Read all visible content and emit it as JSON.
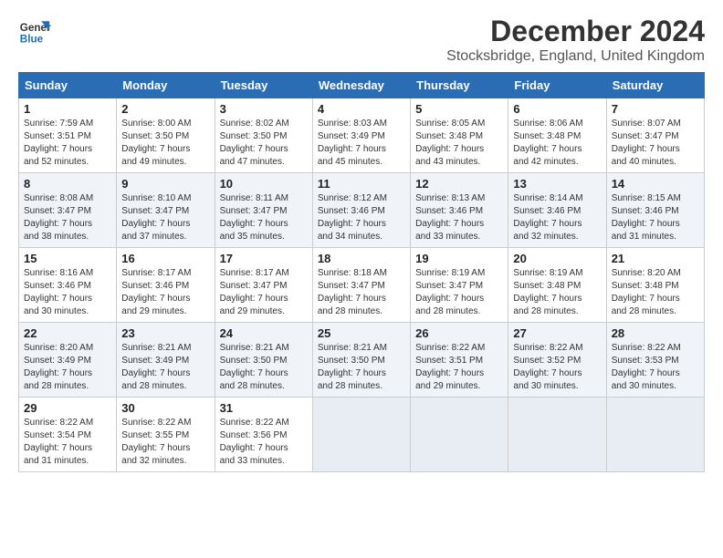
{
  "logo": {
    "line1": "General",
    "line2": "Blue"
  },
  "title": "December 2024",
  "subtitle": "Stocksbridge, England, United Kingdom",
  "headers": [
    "Sunday",
    "Monday",
    "Tuesday",
    "Wednesday",
    "Thursday",
    "Friday",
    "Saturday"
  ],
  "weeks": [
    [
      {
        "day": "1",
        "sunrise": "7:59 AM",
        "sunset": "3:51 PM",
        "daylight": "7 hours and 52 minutes."
      },
      {
        "day": "2",
        "sunrise": "8:00 AM",
        "sunset": "3:50 PM",
        "daylight": "7 hours and 49 minutes."
      },
      {
        "day": "3",
        "sunrise": "8:02 AM",
        "sunset": "3:50 PM",
        "daylight": "7 hours and 47 minutes."
      },
      {
        "day": "4",
        "sunrise": "8:03 AM",
        "sunset": "3:49 PM",
        "daylight": "7 hours and 45 minutes."
      },
      {
        "day": "5",
        "sunrise": "8:05 AM",
        "sunset": "3:48 PM",
        "daylight": "7 hours and 43 minutes."
      },
      {
        "day": "6",
        "sunrise": "8:06 AM",
        "sunset": "3:48 PM",
        "daylight": "7 hours and 42 minutes."
      },
      {
        "day": "7",
        "sunrise": "8:07 AM",
        "sunset": "3:47 PM",
        "daylight": "7 hours and 40 minutes."
      }
    ],
    [
      {
        "day": "8",
        "sunrise": "8:08 AM",
        "sunset": "3:47 PM",
        "daylight": "7 hours and 38 minutes."
      },
      {
        "day": "9",
        "sunrise": "8:10 AM",
        "sunset": "3:47 PM",
        "daylight": "7 hours and 37 minutes."
      },
      {
        "day": "10",
        "sunrise": "8:11 AM",
        "sunset": "3:47 PM",
        "daylight": "7 hours and 35 minutes."
      },
      {
        "day": "11",
        "sunrise": "8:12 AM",
        "sunset": "3:46 PM",
        "daylight": "7 hours and 34 minutes."
      },
      {
        "day": "12",
        "sunrise": "8:13 AM",
        "sunset": "3:46 PM",
        "daylight": "7 hours and 33 minutes."
      },
      {
        "day": "13",
        "sunrise": "8:14 AM",
        "sunset": "3:46 PM",
        "daylight": "7 hours and 32 minutes."
      },
      {
        "day": "14",
        "sunrise": "8:15 AM",
        "sunset": "3:46 PM",
        "daylight": "7 hours and 31 minutes."
      }
    ],
    [
      {
        "day": "15",
        "sunrise": "8:16 AM",
        "sunset": "3:46 PM",
        "daylight": "7 hours and 30 minutes."
      },
      {
        "day": "16",
        "sunrise": "8:17 AM",
        "sunset": "3:46 PM",
        "daylight": "7 hours and 29 minutes."
      },
      {
        "day": "17",
        "sunrise": "8:17 AM",
        "sunset": "3:47 PM",
        "daylight": "7 hours and 29 minutes."
      },
      {
        "day": "18",
        "sunrise": "8:18 AM",
        "sunset": "3:47 PM",
        "daylight": "7 hours and 28 minutes."
      },
      {
        "day": "19",
        "sunrise": "8:19 AM",
        "sunset": "3:47 PM",
        "daylight": "7 hours and 28 minutes."
      },
      {
        "day": "20",
        "sunrise": "8:19 AM",
        "sunset": "3:48 PM",
        "daylight": "7 hours and 28 minutes."
      },
      {
        "day": "21",
        "sunrise": "8:20 AM",
        "sunset": "3:48 PM",
        "daylight": "7 hours and 28 minutes."
      }
    ],
    [
      {
        "day": "22",
        "sunrise": "8:20 AM",
        "sunset": "3:49 PM",
        "daylight": "7 hours and 28 minutes."
      },
      {
        "day": "23",
        "sunrise": "8:21 AM",
        "sunset": "3:49 PM",
        "daylight": "7 hours and 28 minutes."
      },
      {
        "day": "24",
        "sunrise": "8:21 AM",
        "sunset": "3:50 PM",
        "daylight": "7 hours and 28 minutes."
      },
      {
        "day": "25",
        "sunrise": "8:21 AM",
        "sunset": "3:50 PM",
        "daylight": "7 hours and 28 minutes."
      },
      {
        "day": "26",
        "sunrise": "8:22 AM",
        "sunset": "3:51 PM",
        "daylight": "7 hours and 29 minutes."
      },
      {
        "day": "27",
        "sunrise": "8:22 AM",
        "sunset": "3:52 PM",
        "daylight": "7 hours and 30 minutes."
      },
      {
        "day": "28",
        "sunrise": "8:22 AM",
        "sunset": "3:53 PM",
        "daylight": "7 hours and 30 minutes."
      }
    ],
    [
      {
        "day": "29",
        "sunrise": "8:22 AM",
        "sunset": "3:54 PM",
        "daylight": "7 hours and 31 minutes."
      },
      {
        "day": "30",
        "sunrise": "8:22 AM",
        "sunset": "3:55 PM",
        "daylight": "7 hours and 32 minutes."
      },
      {
        "day": "31",
        "sunrise": "8:22 AM",
        "sunset": "3:56 PM",
        "daylight": "7 hours and 33 minutes."
      },
      null,
      null,
      null,
      null
    ]
  ],
  "labels": {
    "sunrise": "Sunrise:",
    "sunset": "Sunset:",
    "daylight": "Daylight:"
  }
}
